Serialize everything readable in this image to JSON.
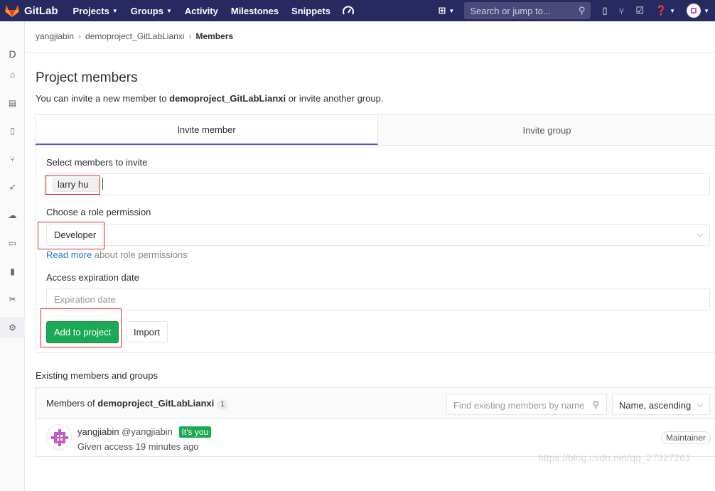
{
  "navbar": {
    "logo_text": "GitLab",
    "items": [
      {
        "label": "Projects",
        "dropdown": true
      },
      {
        "label": "Groups",
        "dropdown": true
      },
      {
        "label": "Activity",
        "dropdown": false
      },
      {
        "label": "Milestones",
        "dropdown": false
      },
      {
        "label": "Snippets",
        "dropdown": false
      }
    ],
    "search_placeholder": "Search or jump to...",
    "bg_color": "#292961"
  },
  "sidebar": {
    "project_initial": "D",
    "items": [
      "home-icon",
      "repository-icon",
      "issues-icon",
      "merge-requests-icon",
      "ci-cd-icon",
      "operations-icon",
      "environments-icon",
      "wiki-icon",
      "snippets-icon",
      "settings-icon"
    ]
  },
  "breadcrumb": {
    "user": "yangjiabin",
    "project": "demoproject_GitLabLianxi",
    "current": "Members"
  },
  "page": {
    "title": "Project members",
    "subtitle_prefix": "You can invite a new member to ",
    "subtitle_project": "demoproject_GitLabLianxi",
    "subtitle_suffix": " or invite another group."
  },
  "tabs": {
    "invite_member": "Invite member",
    "invite_group": "Invite group"
  },
  "form": {
    "select_members_label": "Select members to invite",
    "selected_member": "larry hu",
    "role_label": "Choose a role permission",
    "role_value": "Developer",
    "read_more_link": "Read more",
    "read_more_suffix": " about role permissions",
    "expiration_label": "Access expiration date",
    "expiration_placeholder": "Expiration date",
    "add_button": "Add to project",
    "import_button": "Import"
  },
  "existing": {
    "section_title": "Existing members and groups",
    "members_of_prefix": "Members of ",
    "project": "demoproject_GitLabLianxi",
    "count": "1",
    "filter_placeholder": "Find existing members by name",
    "sort_value": "Name, ascending",
    "members": [
      {
        "name": "yangjiabin",
        "handle": "@yangjiabin",
        "badge": "It's you",
        "access": "Given access 19 minutes ago",
        "role": "Maintainer"
      }
    ]
  },
  "watermark": "https://blog.csdn.net/qq_27327261",
  "colors": {
    "accent": "#1aaa55",
    "tab_underline": "#6b4fbb",
    "link": "#1f78d1",
    "highlight": "#e0252a"
  }
}
